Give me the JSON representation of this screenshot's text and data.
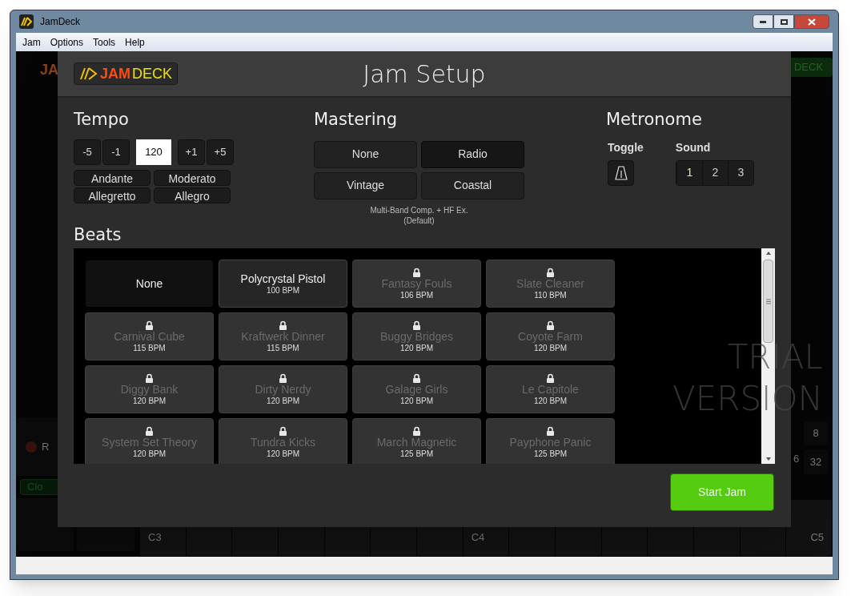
{
  "window": {
    "title": "JamDeck"
  },
  "menu": [
    "Jam",
    "Options",
    "Tools",
    "Help"
  ],
  "background": {
    "logo_partial": "JA",
    "header_button": "DECK",
    "record_label": "R",
    "clock_button": "Clo",
    "step_buttons": [
      "8",
      "32"
    ],
    "partial_step": "6",
    "keys": [
      "C3",
      "C4",
      "C5"
    ],
    "trial_text": [
      "TRIAL",
      "VERSION"
    ]
  },
  "dialog": {
    "logo": {
      "left": "JAM",
      "right": "DECK"
    },
    "title": "Jam Setup",
    "tempo": {
      "heading": "Tempo",
      "down": [
        "-5",
        "-1"
      ],
      "value": "120",
      "up": [
        "+1",
        "+5"
      ],
      "presets": [
        {
          "label": "Andante",
          "selected": false
        },
        {
          "label": "Moderato",
          "selected": false
        },
        {
          "label": "Allegretto",
          "selected": false
        },
        {
          "label": "Allegro",
          "selected": false
        }
      ]
    },
    "mastering": {
      "heading": "Mastering",
      "options": [
        {
          "label": "None",
          "selected": false
        },
        {
          "label": "Radio",
          "selected": true
        },
        {
          "label": "Vintage",
          "selected": false
        },
        {
          "label": "Coastal",
          "selected": false
        }
      ],
      "note": [
        "Multi-Band Comp. + HF Ex.",
        "(Default)"
      ]
    },
    "metronome": {
      "heading": "Metronome",
      "toggle_label": "Toggle",
      "sound_label": "Sound",
      "sounds": [
        {
          "label": "1",
          "selected": true
        },
        {
          "label": "2",
          "selected": false
        },
        {
          "label": "3",
          "selected": false
        }
      ]
    },
    "beats": {
      "heading": "Beats",
      "items": [
        {
          "name": "None",
          "selected": true,
          "locked": false
        },
        {
          "name": "Polycrystal Pistol",
          "bpm": "100 BPM",
          "selected": false,
          "locked": false
        },
        {
          "name": "Fantasy Fouls",
          "bpm": "106 BPM",
          "selected": false,
          "locked": true
        },
        {
          "name": "Slate Cleaner",
          "bpm": "110 BPM",
          "selected": false,
          "locked": true
        },
        {
          "name": "Carnival Cube",
          "bpm": "115 BPM",
          "selected": false,
          "locked": true
        },
        {
          "name": "Kraftwerk Dinner",
          "bpm": "115 BPM",
          "selected": false,
          "locked": true
        },
        {
          "name": "Buggy Bridges",
          "bpm": "120 BPM",
          "selected": false,
          "locked": true
        },
        {
          "name": "Coyote Farm",
          "bpm": "120 BPM",
          "selected": false,
          "locked": true
        },
        {
          "name": "Diggy Bank",
          "bpm": "120 BPM",
          "selected": false,
          "locked": true
        },
        {
          "name": "Dirty Nerdy",
          "bpm": "120 BPM",
          "selected": false,
          "locked": true
        },
        {
          "name": "Galage Girls",
          "bpm": "120 BPM",
          "selected": false,
          "locked": true
        },
        {
          "name": "Le Capitole",
          "bpm": "120 BPM",
          "selected": false,
          "locked": true
        },
        {
          "name": "System Set Theory",
          "bpm": "120 BPM",
          "selected": false,
          "locked": true
        },
        {
          "name": "Tundra Kicks",
          "bpm": "120 BPM",
          "selected": false,
          "locked": true
        },
        {
          "name": "March Magnetic",
          "bpm": "125 BPM",
          "selected": false,
          "locked": true
        },
        {
          "name": "Payphone Panic",
          "bpm": "125 BPM",
          "selected": false,
          "locked": true
        }
      ]
    },
    "start_button": "Start Jam"
  }
}
